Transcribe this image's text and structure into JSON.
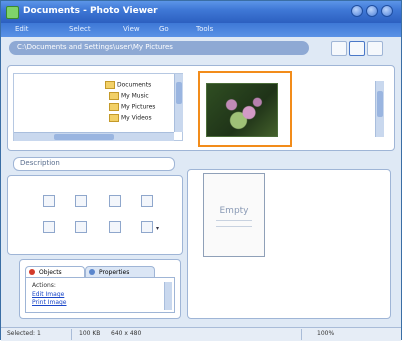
{
  "window": {
    "title": "Documents - Photo Viewer"
  },
  "menu": {
    "items": [
      "Edit",
      "Select",
      "View",
      "Go",
      "Tools"
    ]
  },
  "path": {
    "value": "C:\\Documents and Settings\\user\\My Pictures"
  },
  "tree": {
    "items": [
      "Documents",
      "My Music",
      "My Pictures",
      "My Videos"
    ]
  },
  "section": {
    "label": "Description"
  },
  "preview": {
    "placeholder": "Empty"
  },
  "tabs": {
    "active": "Objects",
    "inactive": "Properties"
  },
  "task_panel": {
    "heading": "Actions:",
    "links": [
      "Edit Image",
      "Print Image"
    ]
  },
  "status": {
    "selected": "Selected: 1",
    "size": "100 KB",
    "dimensions": "640 x 480",
    "zoom": "100%"
  },
  "colors": {
    "accent": "#f28c1a",
    "titlebar": "#2c5fc0"
  }
}
